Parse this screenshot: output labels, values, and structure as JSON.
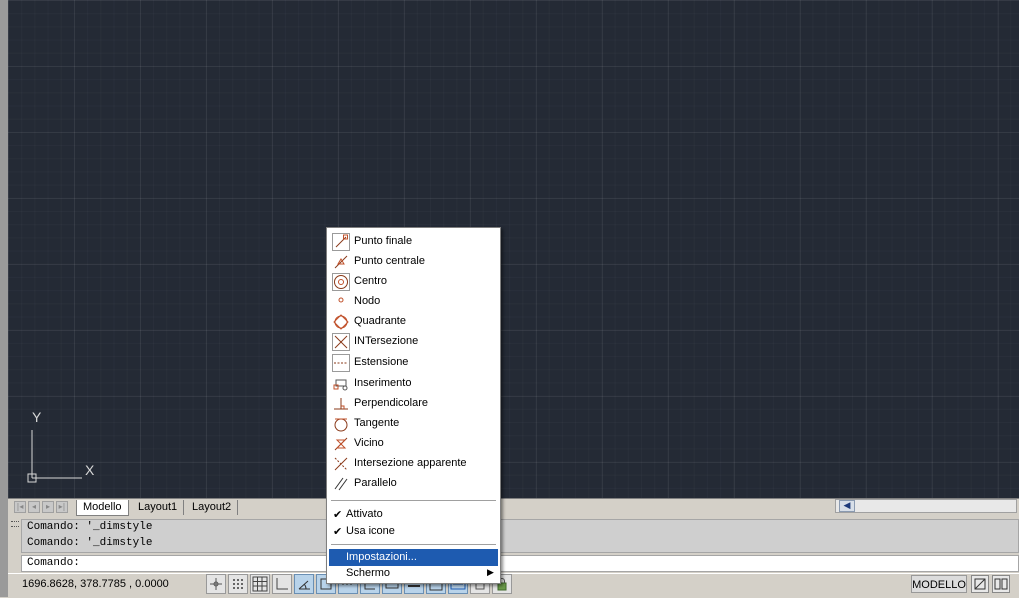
{
  "ucs": {
    "x_label": "X",
    "y_label": "Y"
  },
  "layout_tabs": [
    {
      "label": "Modello",
      "active": true
    },
    {
      "label": "Layout1",
      "active": false
    },
    {
      "label": "Layout2",
      "active": false
    }
  ],
  "command_history": [
    "Comando: '_dimstyle",
    "Comando: '_dimstyle"
  ],
  "command_prompt": "Comando:",
  "status": {
    "coordinates": "1696.8628, 378.7785 , 0.0000",
    "space_label": "MODELLO"
  },
  "osnap_menu": {
    "snap_items": [
      {
        "label": "Punto finale",
        "icon": "endpoint-icon"
      },
      {
        "label": "Punto centrale",
        "icon": "midpoint-icon"
      },
      {
        "label": "Centro",
        "icon": "center-icon"
      },
      {
        "label": "Nodo",
        "icon": "node-icon"
      },
      {
        "label": "Quadrante",
        "icon": "quadrant-icon"
      },
      {
        "label": "INTersezione",
        "icon": "intersection-icon"
      },
      {
        "label": "Estensione",
        "icon": "extension-icon"
      },
      {
        "label": "Inserimento",
        "icon": "insertion-icon"
      },
      {
        "label": "Perpendicolare",
        "icon": "perpendicular-icon"
      },
      {
        "label": "Tangente",
        "icon": "tangent-icon"
      },
      {
        "label": "Vicino",
        "icon": "nearest-icon"
      },
      {
        "label": "Intersezione apparente",
        "icon": "apparent-intersection-icon"
      },
      {
        "label": "Parallelo",
        "icon": "parallel-icon"
      }
    ],
    "toggles": [
      {
        "label": "Attivato",
        "checked": true
      },
      {
        "label": "Usa icone",
        "checked": true
      }
    ],
    "settings_label": "Impostazioni...",
    "display_label": "Schermo"
  },
  "colors": {
    "canvas": "#242a35",
    "menu_highlight": "#1e5bb0",
    "snap_icon": "#c0502a"
  }
}
